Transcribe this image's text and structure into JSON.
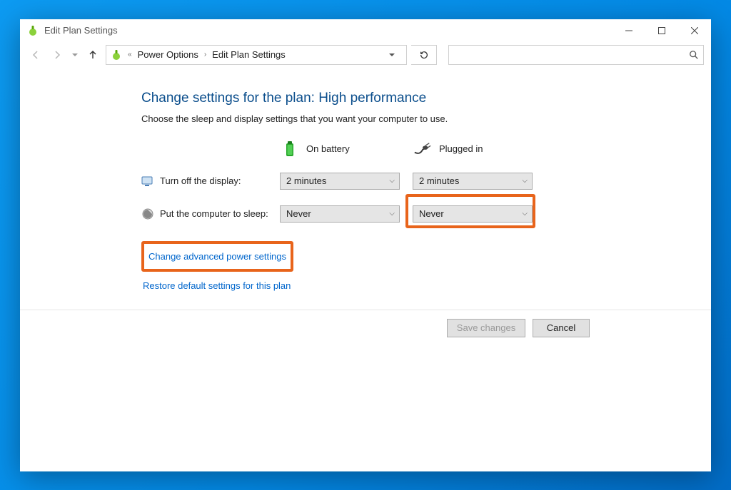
{
  "window": {
    "title": "Edit Plan Settings"
  },
  "breadcrumb": {
    "parent": "Power Options",
    "current": "Edit Plan Settings"
  },
  "search": {
    "placeholder": ""
  },
  "page": {
    "heading": "Change settings for the plan: High performance",
    "subheading": "Choose the sleep and display settings that you want your computer to use."
  },
  "columns": {
    "battery": "On battery",
    "plugged": "Plugged in"
  },
  "rows": {
    "display": {
      "label": "Turn off the display:",
      "battery_value": "2 minutes",
      "plugged_value": "2 minutes"
    },
    "sleep": {
      "label": "Put the computer to sleep:",
      "battery_value": "Never",
      "plugged_value": "Never"
    }
  },
  "links": {
    "advanced": "Change advanced power settings",
    "restore": "Restore default settings for this plan"
  },
  "buttons": {
    "save": "Save changes",
    "cancel": "Cancel"
  }
}
